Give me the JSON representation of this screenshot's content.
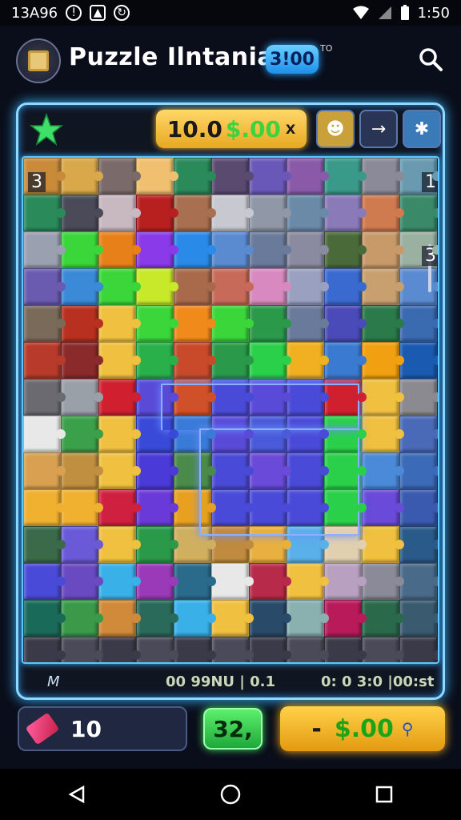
{
  "status_bar": {
    "left_text": "13A96",
    "time": "1:50"
  },
  "header": {
    "title": "Puzzle Ilntaniah",
    "badge": "3!00",
    "badge_sup": "TO"
  },
  "topbar": {
    "score_main": "10.0",
    "score_money": "$.00",
    "score_tail": "X"
  },
  "side_numbers": {
    "left_top": "3",
    "right_top": "1",
    "right_second": "3"
  },
  "bottom_info": {
    "left": "M",
    "middle": "00 99NU | 0.1",
    "right": "0: 0  3:0  |00:st"
  },
  "footer": {
    "left_value": "10",
    "middle_value": "32,",
    "right_dash": "-",
    "right_value": "$.00"
  },
  "colors": {
    "accent_glow": "#8fd9ff",
    "gold": "#e8a820",
    "green": "#3ed33e"
  },
  "puzzle_colors": [
    "#c98a3a",
    "#d9a84a",
    "#7a6a6a",
    "#f0c070",
    "#2a8a5a",
    "#5a4a70",
    "#6a58b8",
    "#8a5aa8",
    "#3a9a8a",
    "#8a8a98",
    "#6a9ab0",
    "#2a8a5a",
    "#4a4a58",
    "#c8b8c0",
    "#b82020",
    "#a87050",
    "#c8c8d0",
    "#9098a8",
    "#6a8aa8",
    "#8a7ab8",
    "#d07a50",
    "#3a8a6a",
    "#9aa0b0",
    "#3ad63a",
    "#e8801a",
    "#8a3ae8",
    "#2a8ae8",
    "#5a8ad0",
    "#6a7a9a",
    "#8a8aa0",
    "#4a6a3a",
    "#c89a6a",
    "#9ab0a0",
    "#6a5ab0",
    "#3a8ad8",
    "#3ad63a",
    "#c8e82a",
    "#a86a4a",
    "#c86a5a",
    "#d88ac0",
    "#9aa0c0",
    "#3a6ad0",
    "#c8a070",
    "#5a8ad0",
    "#7a6a5a",
    "#b83020",
    "#f0c040",
    "#3ad63a",
    "#f08a1a",
    "#3ad63a",
    "#2a9a4a",
    "#6a7a9a",
    "#4a4ab8",
    "#2a7a4a",
    "#3a6ab0",
    "#b83a2a",
    "#8a2a2a",
    "#f0c040",
    "#2ab04a",
    "#c84a2a",
    "#2a9a4a",
    "#2ad04a",
    "#f0b020",
    "#3a7ad0",
    "#f0a010",
    "#1a5ab0",
    "#6a6a70",
    "#9aa0a8",
    "#d02030",
    "#5a4ad8",
    "#d0502a",
    "#4a4ad8",
    "#5a4ad8",
    "#4a4ad8",
    "#d02030",
    "#f0c040",
    "#8a8a90",
    "#e8e8e8",
    "#3aa04a",
    "#f0c040",
    "#3a4ad8",
    "#3a7ad8",
    "#5a4ad8",
    "#4a5ad8",
    "#4a4ad8",
    "#2ad04a",
    "#f0c040",
    "#4a6ab8",
    "#d8a050",
    "#c09040",
    "#f0c040",
    "#4a3ad8",
    "#4a8a4a",
    "#4a4ad8",
    "#6a4ad8",
    "#4a4ad8",
    "#2ad04a",
    "#4a8ad8",
    "#3a6ab8",
    "#f0b030",
    "#f0b030",
    "#d02040",
    "#6a3ad8",
    "#e8a020",
    "#4a4ad8",
    "#4a4ad8",
    "#4a4ad8",
    "#2ad04a",
    "#6a4ad8",
    "#3a5ab0",
    "#3a6a4a",
    "#6a5ad8",
    "#f0c040",
    "#2a9a4a",
    "#d0b060",
    "#c08a40",
    "#e8b040",
    "#5ab0e8",
    "#e0d0b0",
    "#f0c040",
    "#2a5a8a",
    "#4a4ad8",
    "#6a4ac0",
    "#3ab0e8",
    "#9a3ab8",
    "#2a6a8a",
    "#e8e8e8",
    "#b82a4a",
    "#f0c040",
    "#b8a0c0",
    "#8a8a98",
    "#4a6a8a",
    "#1a6a5a",
    "#3a9a4a",
    "#d08a3a",
    "#2a6a5a",
    "#3ab0e8",
    "#f0c040",
    "#2a4a6a",
    "#8ab0b0",
    "#b81a5a",
    "#2a6a4a",
    "#3a5a70",
    "#3a3a48",
    "#4a4a58",
    "#3a3a48",
    "#4a4a58",
    "#3a3a48",
    "#4a4a58",
    "#3a3a48",
    "#4a4a58",
    "#3a3a48",
    "#4a4a58",
    "#3a3a48",
    "#2a2a38",
    "#2a2a38",
    "#2a2a38",
    "#2a2a38",
    "#2a2a38",
    "#2a2a38",
    "#2a2a38",
    "#2a2a38",
    "#2a2a38",
    "#2a2a38",
    "#2a2a38"
  ]
}
